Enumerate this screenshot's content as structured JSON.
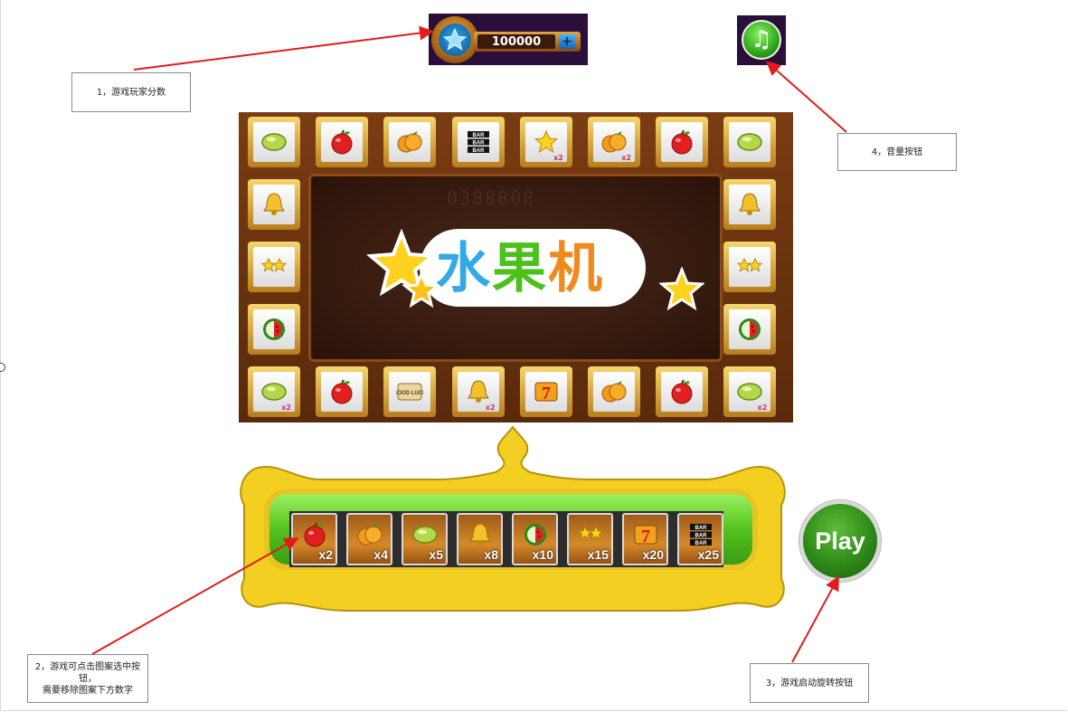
{
  "score": {
    "value": "100000",
    "plus_label": "+"
  },
  "board": {
    "screen_ghost_text": "0388808",
    "logo_chars": [
      "水",
      "果",
      "机"
    ],
    "top_row": [
      {
        "icon": "lime-icon",
        "tag": ""
      },
      {
        "icon": "apple-icon",
        "tag": ""
      },
      {
        "icon": "orange-icon",
        "tag": ""
      },
      {
        "icon": "bar-icon",
        "tag": ""
      },
      {
        "icon": "star-icon",
        "tag": "x2"
      },
      {
        "icon": "orange-icon",
        "tag": "x2"
      },
      {
        "icon": "apple-icon",
        "tag": ""
      },
      {
        "icon": "lime-icon",
        "tag": ""
      }
    ],
    "left_col": [
      {
        "icon": "bell-icon",
        "tag": ""
      },
      {
        "icon": "double-star-icon",
        "tag": ""
      },
      {
        "icon": "watermelon-icon",
        "tag": ""
      }
    ],
    "right_col": [
      {
        "icon": "bell-icon",
        "tag": ""
      },
      {
        "icon": "double-star-icon",
        "tag": ""
      },
      {
        "icon": "watermelon-icon",
        "tag": ""
      }
    ],
    "bottom_row": [
      {
        "icon": "lime-icon",
        "tag": "x2"
      },
      {
        "icon": "apple-icon",
        "tag": ""
      },
      {
        "icon": "good-luck-icon",
        "tag": ""
      },
      {
        "icon": "bell-icon",
        "tag": "x2"
      },
      {
        "icon": "seven-icon",
        "tag": ""
      },
      {
        "icon": "orange-icon",
        "tag": ""
      },
      {
        "icon": "apple-icon",
        "tag": ""
      },
      {
        "icon": "lime-icon",
        "tag": "x2"
      }
    ]
  },
  "good_luck_text": "GOOD LUCK",
  "bar_text": "BAR",
  "bets": [
    {
      "icon": "apple-icon",
      "mult": "x2"
    },
    {
      "icon": "orange-icon",
      "mult": "x4"
    },
    {
      "icon": "lime-icon",
      "mult": "x5"
    },
    {
      "icon": "bell-icon",
      "mult": "x8"
    },
    {
      "icon": "watermelon-icon",
      "mult": "x10"
    },
    {
      "icon": "double-star-icon",
      "mult": "x15"
    },
    {
      "icon": "seven-icon",
      "mult": "x20"
    },
    {
      "icon": "bar-icon",
      "mult": "x25"
    }
  ],
  "play_label": "Play",
  "notes": {
    "score": "1，游戏玩家分数",
    "volume": "4，音量按钮",
    "bets_line1": "2，游戏可点击图案选中按钮，",
    "bets_line2": "需要移除图案下方数字",
    "play": "3，游戏启动旋转按钮"
  },
  "colors": {
    "arrow": "#e31b1b",
    "accent_gold": "#e7c422",
    "play_green": "#2d8a18"
  }
}
